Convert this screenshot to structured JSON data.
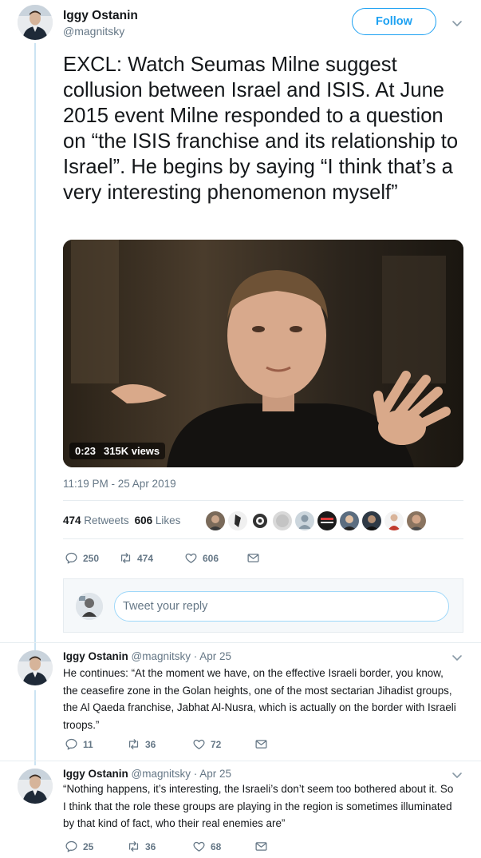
{
  "main_tweet": {
    "author_name": "Iggy Ostanin",
    "author_handle": "@magnitsky",
    "follow_label": "Follow",
    "text": "EXCL: Watch Seumas Milne suggest collusion between Israel and ISIS. At June 2015 event Milne responded to a question on “the ISIS franchise and its relationship to Israel”. He begins by saying “I think that’s a very interesting phenomenon myself”",
    "video_duration": "0:23",
    "video_views": "315K views",
    "timestamp": "11:19 PM - 25 Apr 2019",
    "retweets_count": "474",
    "retweets_label": "Retweets",
    "likes_count": "606",
    "likes_label": "Likes",
    "actions": {
      "replies": "250",
      "retweets": "474",
      "likes": "606"
    }
  },
  "reply_box": {
    "placeholder": "Tweet your reply"
  },
  "replies": [
    {
      "author_name": "Iggy Ostanin",
      "author_handle": "@magnitsky",
      "date": "· Apr 25",
      "text": "He continues: “At the moment we have, on the effective Israeli border, you know, the ceasefire zone in the Golan heights, one of the most sectarian Jihadist groups, the Al Qaeda franchise, Jabhat Al-Nusra, which is actually on the border with Israeli troops.”",
      "replies": "11",
      "retweets": "36",
      "likes": "72"
    },
    {
      "author_name": "Iggy Ostanin",
      "author_handle": "@magnitsky",
      "date": "· Apr 25",
      "text": "“Nothing happens, it’s interesting, the Israeli’s don’t seem too bothered about it. So I think that the role these groups are playing in the region is sometimes illuminated by that kind of fact, who their real enemies are”",
      "replies": "25",
      "retweets": "36",
      "likes": "68"
    }
  ],
  "colors": {
    "accent": "#1da1f2",
    "muted": "#657786",
    "text": "#14171a",
    "thread_line": "#cce4f3",
    "divider": "#e6ecf0"
  }
}
